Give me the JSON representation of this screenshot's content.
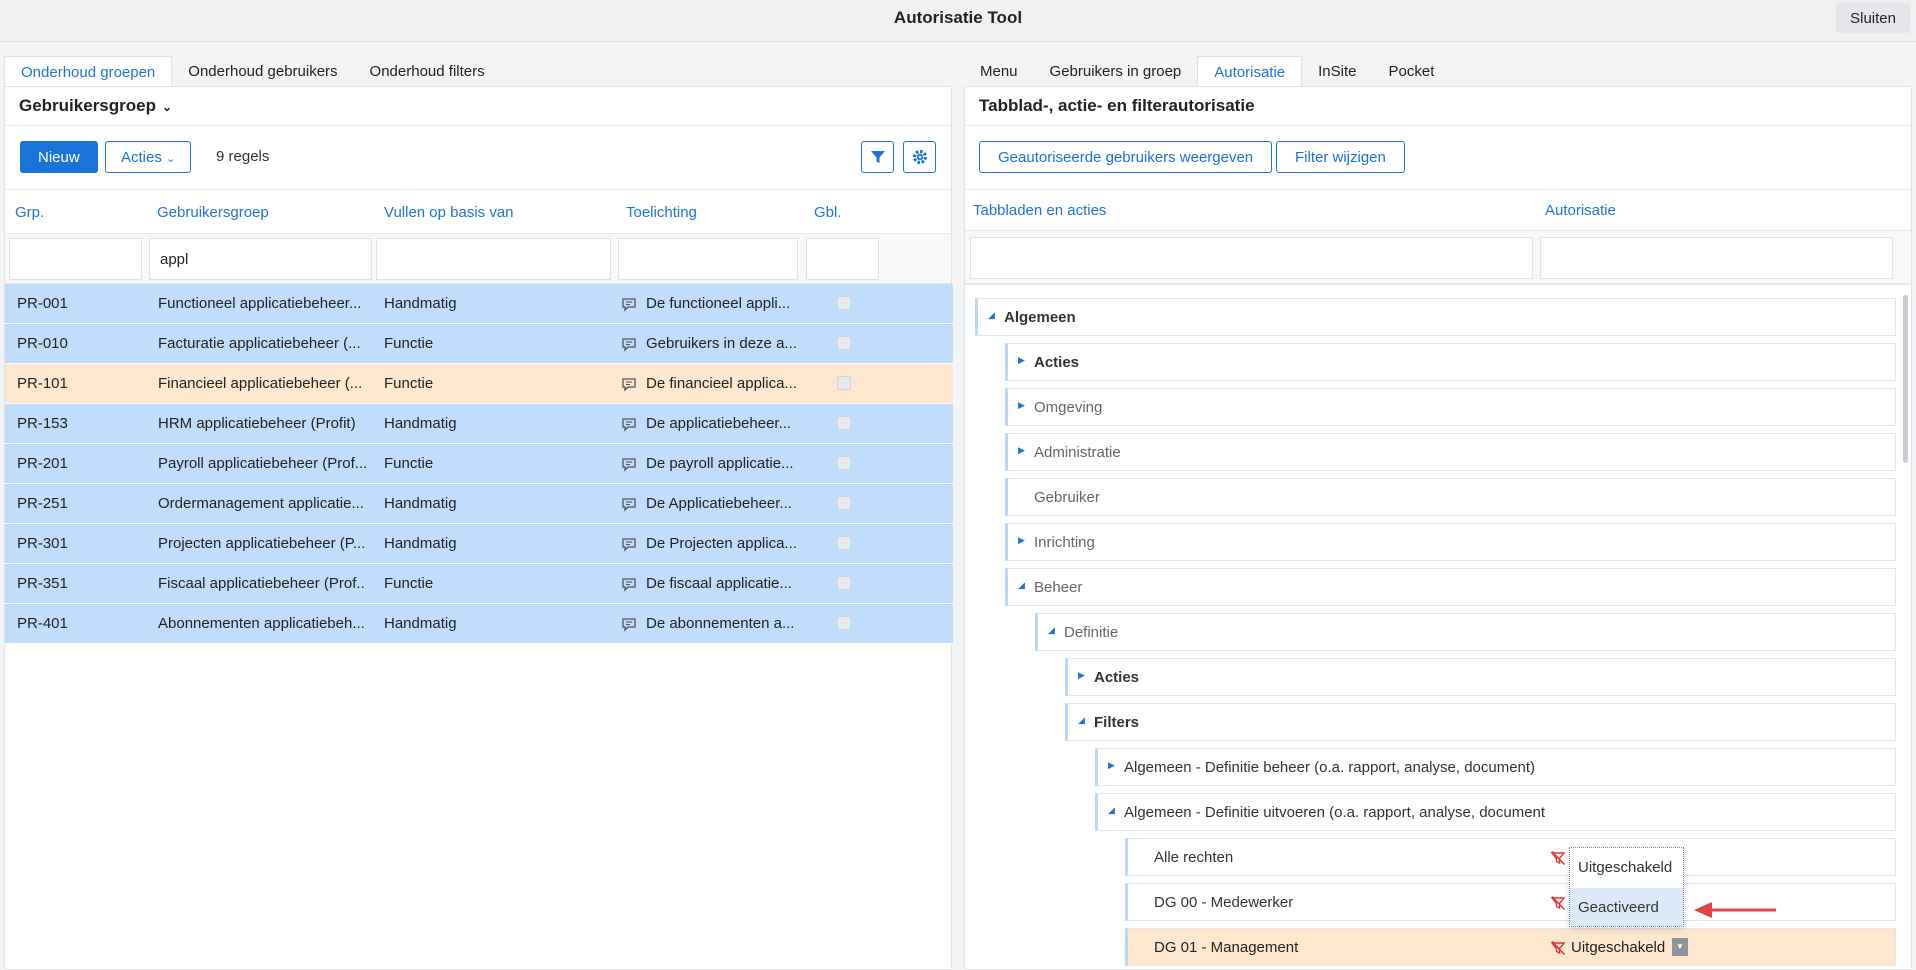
{
  "app": {
    "title": "Autorisatie Tool",
    "close_label": "Sluiten"
  },
  "left_tabs": [
    "Onderhoud groepen",
    "Onderhoud gebruikers",
    "Onderhoud filters"
  ],
  "right_tabs": [
    "Menu",
    "Gebruikers in groep",
    "Autorisatie",
    "InSite",
    "Pocket"
  ],
  "left": {
    "header": "Gebruikersgroep",
    "new_label": "Nieuw",
    "actions_label": "Acties",
    "count": "9 regels",
    "columns": [
      "Grp.",
      "Gebruikersgroep",
      "Vullen op basis van",
      "Toelichting",
      "Gbl."
    ],
    "filters": [
      "",
      "appl",
      "",
      "",
      ""
    ],
    "rows": [
      {
        "code": "PR-001",
        "name": "Functioneel applicatiebeheer...",
        "fill": "Handmatig",
        "note": "De functioneel appli..."
      },
      {
        "code": "PR-010",
        "name": "Facturatie applicatiebeheer (...",
        "fill": "Functie",
        "note": "Gebruikers in deze a..."
      },
      {
        "code": "PR-101",
        "name": "Financieel applicatiebeheer (...",
        "fill": "Functie",
        "note": "De financieel applica..."
      },
      {
        "code": "PR-153",
        "name": "HRM applicatiebeheer (Profit)",
        "fill": "Handmatig",
        "note": "De applicatiebeheer..."
      },
      {
        "code": "PR-201",
        "name": "Payroll applicatiebeheer (Prof...",
        "fill": "Functie",
        "note": "De payroll applicatie..."
      },
      {
        "code": "PR-251",
        "name": "Ordermanagement applicatie...",
        "fill": "Handmatig",
        "note": "De Applicatiebeheer..."
      },
      {
        "code": "PR-301",
        "name": "Projecten applicatiebeheer (P...",
        "fill": "Handmatig",
        "note": "De Projecten applica..."
      },
      {
        "code": "PR-351",
        "name": "Fiscaal applicatiebeheer (Prof...",
        "fill": "Functie",
        "note": "De fiscaal applicatie..."
      },
      {
        "code": "PR-401",
        "name": "Abonnementen applicatiebeh...",
        "fill": "Handmatig",
        "note": "De abonnementen a..."
      }
    ]
  },
  "right": {
    "header": "Tabblad-, actie- en filterautorisatie",
    "btn_users": "Geautoriseerde gebruikers weergeven",
    "btn_filter": "Filter wijzigen",
    "columns": [
      "Tabbladen en acties",
      "Autorisatie"
    ],
    "tree": {
      "algemeen": "Algemeen",
      "acties": "Acties",
      "omgeving": "Omgeving",
      "administratie": "Administratie",
      "gebruiker": "Gebruiker",
      "inrichting": "Inrichting",
      "beheer": "Beheer",
      "definitie": "Definitie",
      "def_acties": "Acties",
      "filters": "Filters",
      "filter1": "Algemeen - Definitie beheer (o.a. rapport, analyse, document)",
      "filter2": "Algemeen - Definitie uitvoeren (o.a. rapport, analyse, document",
      "alle_rechten": "Alle rechten",
      "dg00": "DG 00 - Medewerker",
      "dg01": "DG 01 - Management",
      "dg01_value": "Uitgeschakeld"
    },
    "dropdown": [
      "Uitgeschakeld",
      "Geactiveerd"
    ]
  }
}
